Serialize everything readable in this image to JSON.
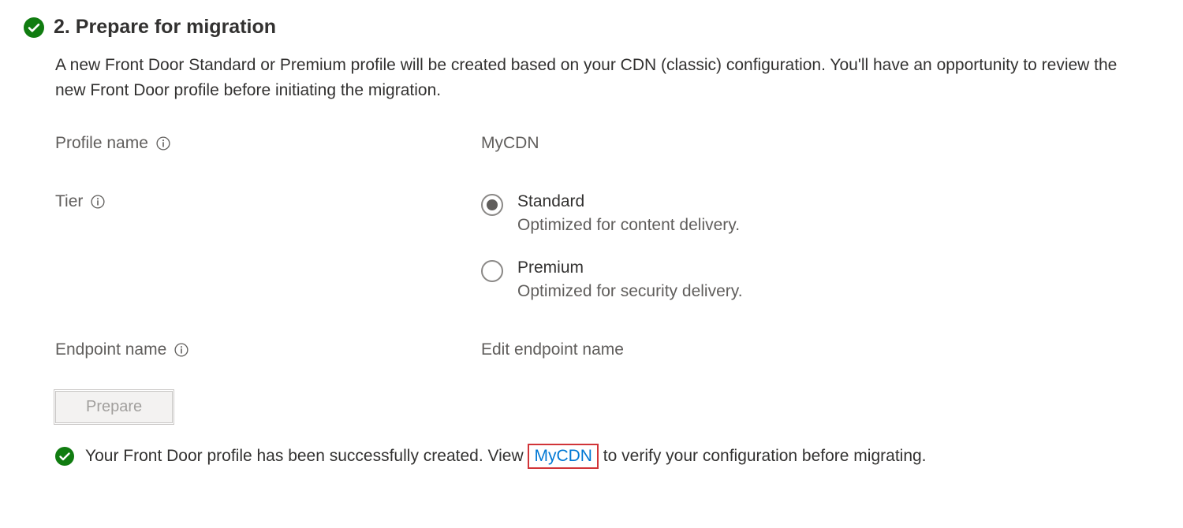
{
  "section": {
    "title": "2. Prepare for migration",
    "description": "A new Front Door Standard or Premium profile will be created based on your CDN (classic) configuration. You'll have an opportunity to review the new Front Door profile before initiating the migration."
  },
  "fields": {
    "profile_name": {
      "label": "Profile name",
      "value": "MyCDN"
    },
    "tier": {
      "label": "Tier",
      "options": [
        {
          "label": "Standard",
          "sublabel": "Optimized for content delivery.",
          "selected": true
        },
        {
          "label": "Premium",
          "sublabel": "Optimized for security delivery.",
          "selected": false
        }
      ]
    },
    "endpoint_name": {
      "label": "Endpoint name",
      "value": "Edit endpoint name"
    }
  },
  "button": {
    "prepare": "Prepare"
  },
  "status": {
    "prefix": "Your Front Door profile has been successfully created. View ",
    "link": "MyCDN",
    "suffix": " to verify your configuration before migrating."
  }
}
